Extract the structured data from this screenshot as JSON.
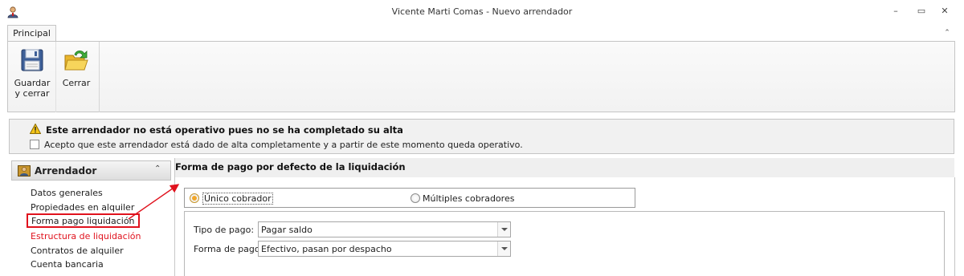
{
  "window": {
    "title": "Vicente Marti Comas - Nuevo arrendador",
    "min_glyph": "–",
    "max_glyph": "▭",
    "close_glyph": "✕"
  },
  "ribbon": {
    "tabs": [
      {
        "label": "Principal"
      }
    ],
    "collapse_glyph": "⌃",
    "buttons": {
      "save_line1": "Guardar",
      "save_line2": "y cerrar",
      "close": "Cerrar"
    }
  },
  "notice": {
    "title": "Este arrendador no está operativo pues no se ha completado su alta",
    "checkbox_label": "Acepto que este arrendador está dado de alta completamente y a partir de este momento queda operativo.",
    "checkbox_checked": false
  },
  "sidebar": {
    "header": "Arrendador",
    "chevron": "⌃",
    "items": [
      {
        "label": "Datos generales",
        "style": "normal"
      },
      {
        "label": "Propiedades en alquiler",
        "style": "normal"
      },
      {
        "label": "Forma pago liquidación",
        "style": "selected"
      },
      {
        "label": "Estructura de liquidación",
        "style": "red"
      },
      {
        "label": "Contratos de alquiler",
        "style": "normal"
      },
      {
        "label": "Cuenta bancaria",
        "style": "normal"
      }
    ]
  },
  "main": {
    "section_title": "Forma de pago por defecto de la liquidación",
    "radios": [
      {
        "label": "Único cobrador",
        "checked": true
      },
      {
        "label": "Múltiples cobradores",
        "checked": false
      }
    ],
    "fields": [
      {
        "label": "Tipo de pago:",
        "value": "Pagar saldo"
      },
      {
        "label": "Forma de pago:",
        "value": "Efectivo, pasan por despacho"
      }
    ]
  },
  "colors": {
    "highlight_red": "#e0121d",
    "radio_checked": "#f2a72a"
  }
}
